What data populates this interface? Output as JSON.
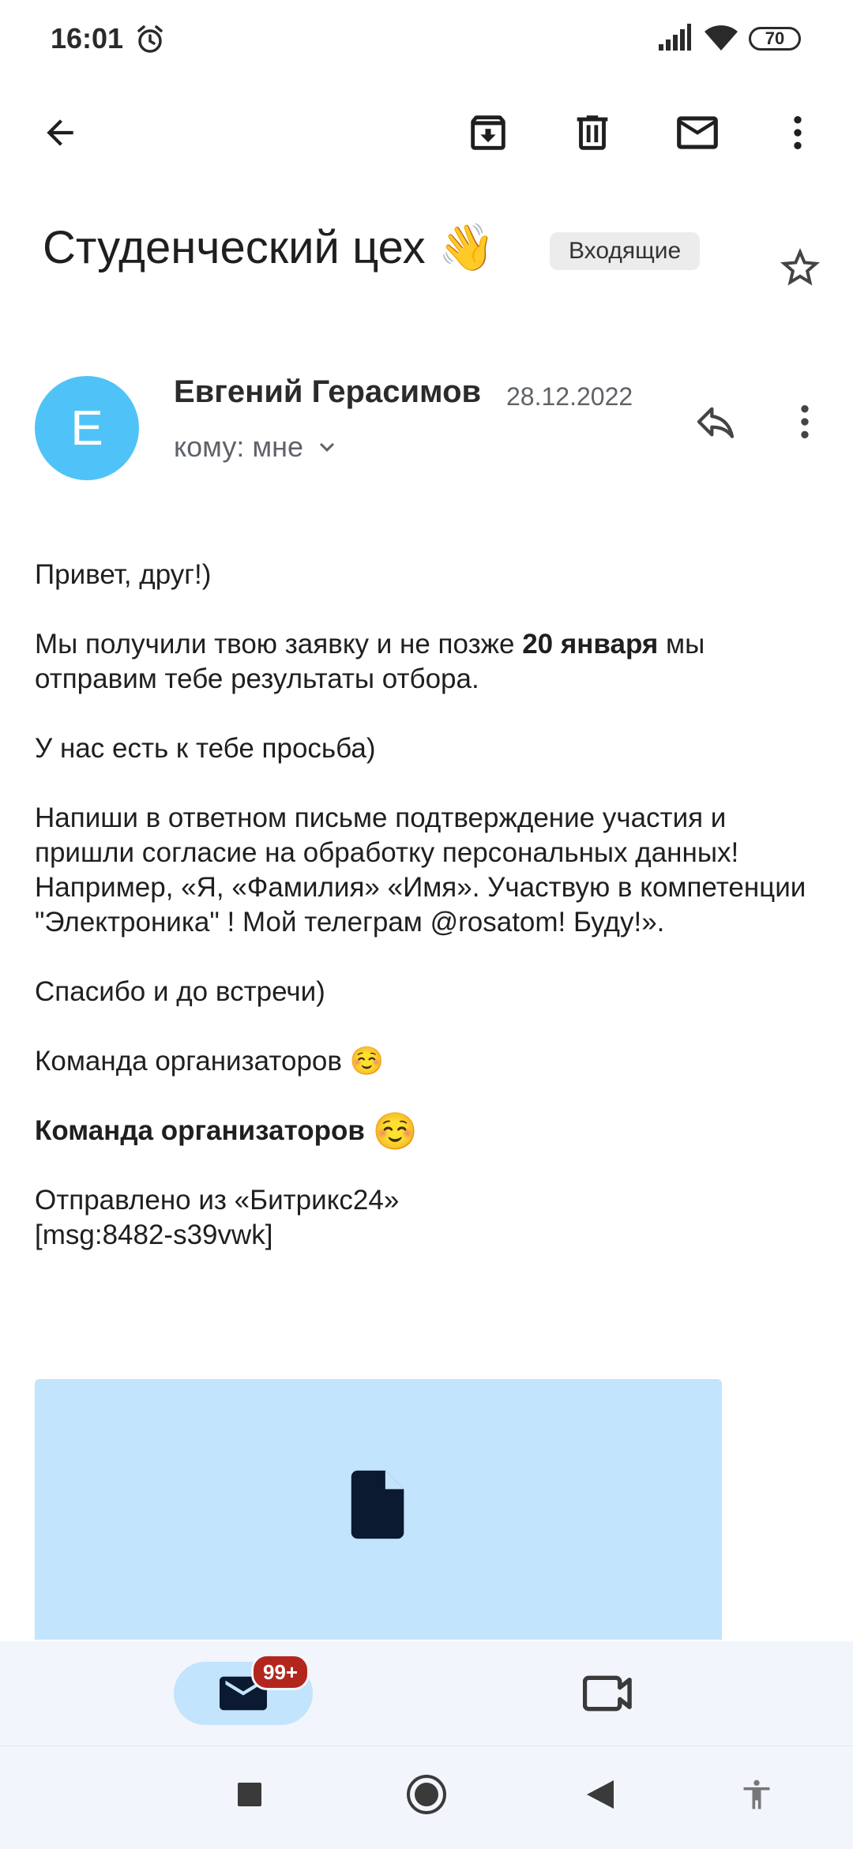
{
  "status_bar": {
    "time": "16:01",
    "battery": "70"
  },
  "toolbar": {
    "back": "back-arrow-icon",
    "archive": "archive-icon",
    "delete": "trash-icon",
    "mark_unread": "mail-icon",
    "more": "more-vert-icon"
  },
  "thread": {
    "subject": "Студенческий цех 👋",
    "label": "Входящие"
  },
  "message": {
    "avatar_letter": "Е",
    "sender": "Евгений Герасимов",
    "date": "28.12.2022",
    "recipients": "кому: мне",
    "body": {
      "greeting": "Привет, друг!)",
      "p2_before": "Мы получили твою заявку и не позже ",
      "p2_bold": "20 января",
      "p2_after": " мы отправим тебе результаты отбора.",
      "p3": "У нас есть к тебе просьба)",
      "p4": "Напиши в ответном письме подтверждение участия и пришли согласие на обработку персональных данных! Например, «Я, «Фамилия» «Имя». Участвую в компетенции  \"Электроника\" ! Мой телеграм @rosatom! Буду!».",
      "p5": "Спасибо и до встречи)",
      "p6": "Команда организаторов ☺️",
      "signature": "Команда организаторов",
      "signature_emoji": "☺️",
      "footer_line1": "Отправлено из «Битрикс24»",
      "footer_line2": "[msg:8482-s39vwk]"
    }
  },
  "bottom_nav": {
    "mail_badge": "99+"
  },
  "colors": {
    "avatar": "#4fc3f7",
    "attachment": "#c2e4fc",
    "badge": "#b3261e",
    "nav_bg": "#f2f5fb"
  }
}
